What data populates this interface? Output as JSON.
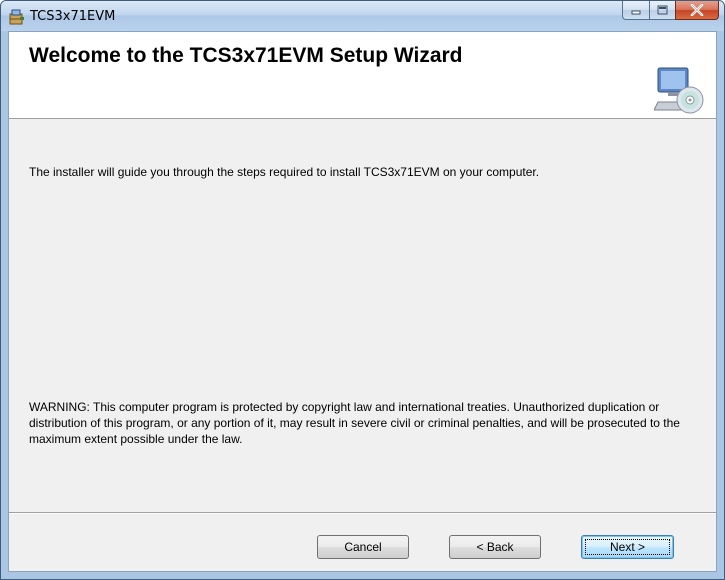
{
  "window": {
    "title": "TCS3x71EVM"
  },
  "banner": {
    "title": "Welcome to the TCS3x71EVM Setup Wizard",
    "icon": "computer-cd-icon"
  },
  "body": {
    "intro": "The installer will guide you through the steps required to install TCS3x71EVM on your computer.",
    "warning": "WARNING: This computer program is protected by copyright law and international treaties. Unauthorized duplication or distribution of this program, or any portion of it, may result in severe civil or criminal penalties, and will be prosecuted to the maximum extent possible under the law."
  },
  "buttons": {
    "cancel": "Cancel",
    "back": "< Back",
    "next": "Next >"
  },
  "colors": {
    "accent": "#3c7fb1",
    "close": "#c54625"
  }
}
